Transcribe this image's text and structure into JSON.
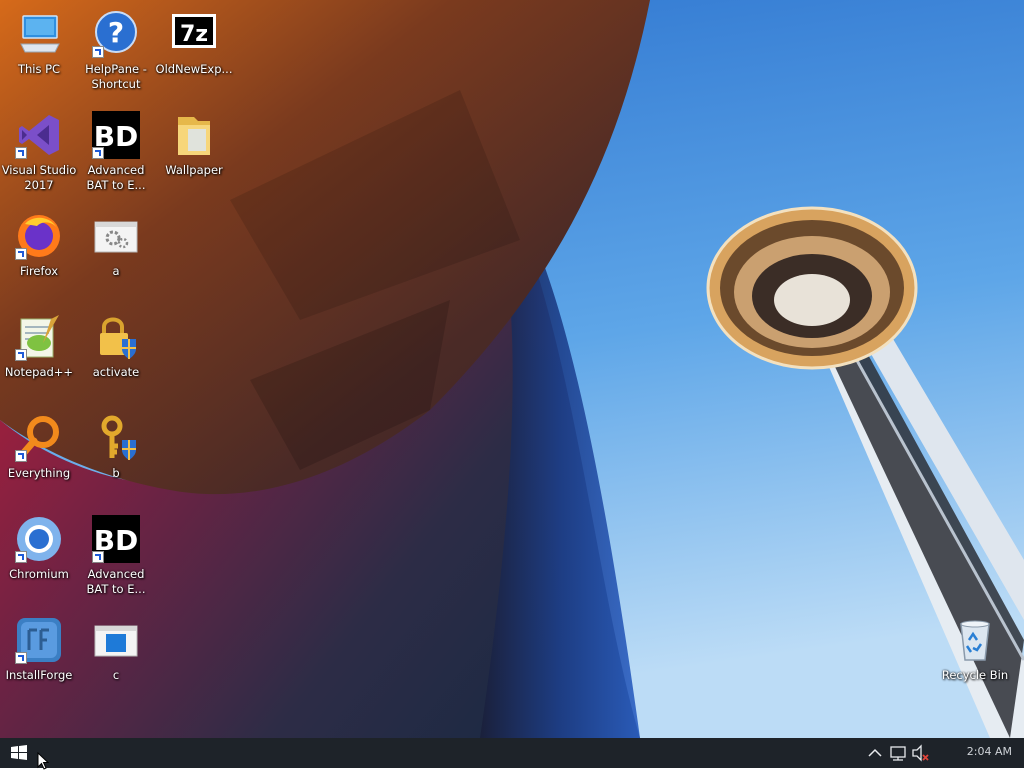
{
  "desktop": {
    "icons": [
      {
        "label": "This PC",
        "icon": "computer-icon",
        "shortcut": false
      },
      {
        "label": "HelpPane - Shortcut",
        "icon": "help-question-icon",
        "shortcut": true
      },
      {
        "label": "OldNewExp...",
        "icon": "seven-zip-icon",
        "shortcut": false
      },
      {
        "label": "Visual Studio 2017",
        "icon": "visual-studio-icon",
        "shortcut": true
      },
      {
        "label": "Advanced BAT to E...",
        "icon": "bat-to-exe-icon",
        "shortcut": true
      },
      {
        "label": "Wallpaper",
        "icon": "folder-icon",
        "shortcut": false
      },
      {
        "label": "Firefox",
        "icon": "firefox-icon",
        "shortcut": true
      },
      {
        "label": "a",
        "icon": "settings-file-icon",
        "shortcut": false
      },
      {
        "label": "Notepad++",
        "icon": "notepad-plus-plus-icon",
        "shortcut": true
      },
      {
        "label": "activate",
        "icon": "lock-shield-icon",
        "shortcut": false
      },
      {
        "label": "Everything",
        "icon": "everything-search-icon",
        "shortcut": true
      },
      {
        "label": "b",
        "icon": "key-shield-icon",
        "shortcut": false
      },
      {
        "label": "Chromium",
        "icon": "chromium-icon",
        "shortcut": true
      },
      {
        "label": "Advanced BAT to E...",
        "icon": "bat-to-exe-icon",
        "shortcut": true
      },
      {
        "label": "InstallForge",
        "icon": "installforge-icon",
        "shortcut": true
      },
      {
        "label": "c",
        "icon": "window-file-icon",
        "shortcut": false
      },
      {
        "label": "Recycle Bin",
        "icon": "recycle-bin-icon",
        "shortcut": false
      }
    ]
  },
  "taskbar": {
    "start_icon": "windows-start-icon",
    "tray": {
      "icons": [
        "chevron-up-icon",
        "network-icon",
        "volume-muted-icon"
      ],
      "clock": "2:04 AM"
    }
  },
  "colors": {
    "taskbar": "#1e2329",
    "sky": "#3a86d8",
    "icon_text": "#ffffff"
  }
}
